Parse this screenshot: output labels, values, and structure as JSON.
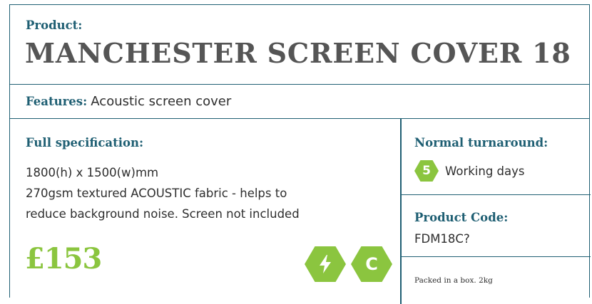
{
  "product": {
    "label": "Product:",
    "name": "MANCHESTER SCREEN COVER 18"
  },
  "features": {
    "label": "Features:",
    "text": "Acoustic screen cover"
  },
  "specification": {
    "label": "Full specification:",
    "lines": [
      "1800(h) x 1500(w)mm",
      "270gsm textured ACOUSTIC fabric - helps to",
      "reduce background noise. Screen not included"
    ]
  },
  "price": "£153",
  "badges": [
    {
      "icon": "lightning-bolt-icon",
      "symbol": "⚡",
      "color": "#8bc53f"
    },
    {
      "icon": "c-letter-icon",
      "symbol": "C",
      "color": "#8bc53f"
    }
  ],
  "turnaround": {
    "label": "Normal turnaround:",
    "days": "5",
    "unit": "Working days"
  },
  "product_code": {
    "label": "Product Code:",
    "value": "FDM18C?"
  },
  "packing": "Packed in a box. 2kg",
  "colors": {
    "border": "#1f5f73",
    "label": "#1f5f73",
    "accent": "#8bc53f",
    "title": "#555555"
  }
}
